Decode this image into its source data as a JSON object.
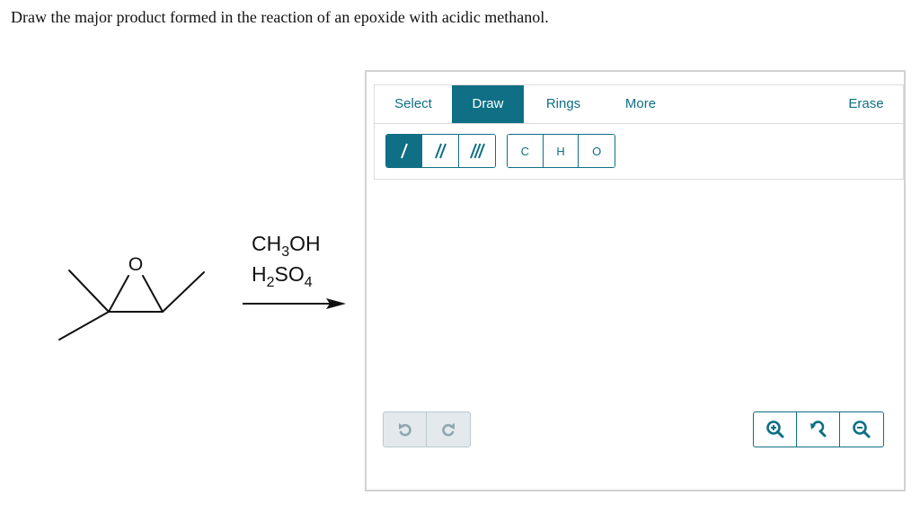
{
  "question": "Draw the major product formed in the reaction of an epoxide with acidic methanol.",
  "reactant": {
    "oxygen_label": "O"
  },
  "reagents": {
    "line1": {
      "a": "CH",
      "sub": "3",
      "b": "OH"
    },
    "line2": {
      "a": "H",
      "sub1": "2",
      "b": "SO",
      "sub2": "4"
    }
  },
  "editor": {
    "tabs": {
      "select": "Select",
      "draw": "Draw",
      "rings": "Rings",
      "more": "More",
      "erase": "Erase"
    },
    "active_tab": "Draw",
    "bond_tools": {
      "icons": [
        "single-bond-icon",
        "double-bond-icon",
        "triple-bond-icon"
      ],
      "active": "single-bond-icon"
    },
    "atoms": [
      "C",
      "H",
      "O"
    ],
    "history_icons": [
      "undo-icon",
      "redo-icon"
    ],
    "zoom_icons": [
      "zoom-in-icon",
      "reset-zoom-icon",
      "zoom-out-icon"
    ]
  },
  "colors": {
    "accent": "#0e6f85",
    "panel_border": "#dcdcdc",
    "editor_border": "#d2d2d2",
    "disabled_bg": "#e3e9ec",
    "disabled_icon": "#8fa7b0"
  }
}
